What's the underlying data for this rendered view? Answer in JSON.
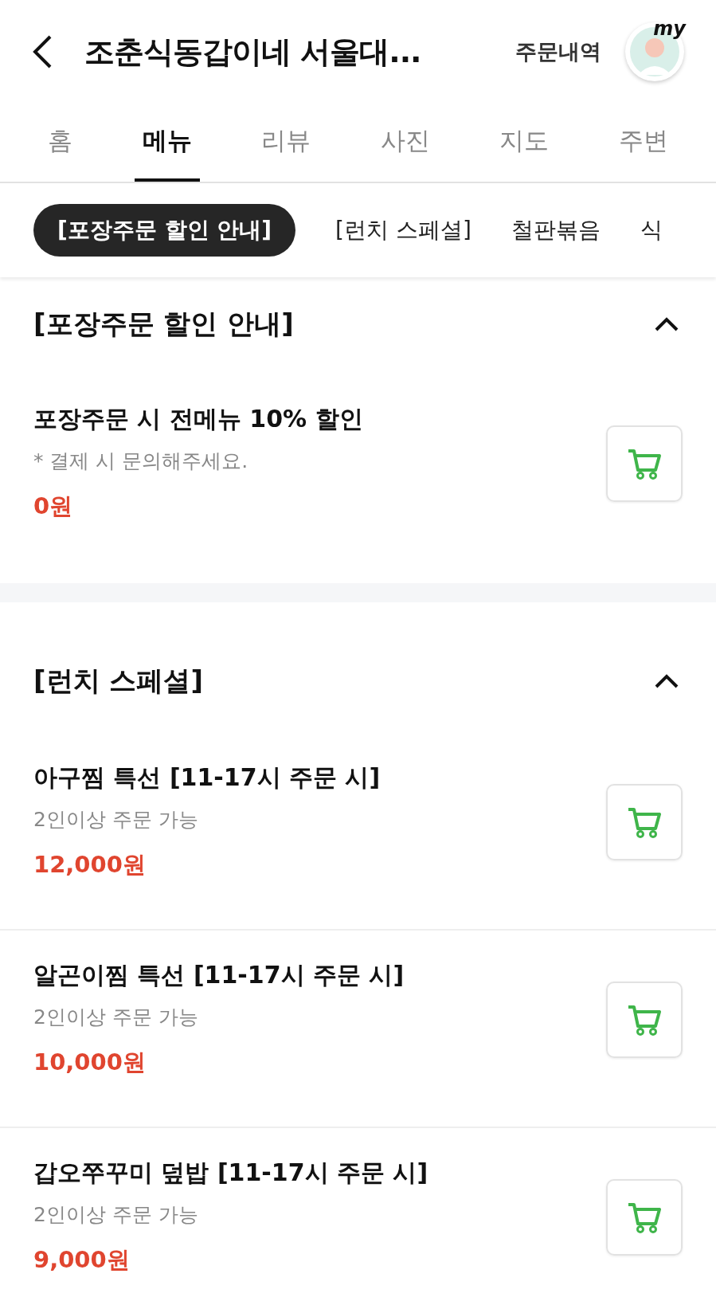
{
  "header": {
    "title": "조춘식동갑이네 서울대...",
    "order_history": "주문내역",
    "avatar_badge": "my"
  },
  "tabs": [
    {
      "label": "홈",
      "selected": false
    },
    {
      "label": "메뉴",
      "selected": true
    },
    {
      "label": "리뷰",
      "selected": false
    },
    {
      "label": "사진",
      "selected": false
    },
    {
      "label": "지도",
      "selected": false
    },
    {
      "label": "주변",
      "selected": false
    }
  ],
  "category_chips": [
    {
      "label": "[포장주문 할인 안내]",
      "selected": true
    },
    {
      "label": "[런치 스페셜]",
      "selected": false
    },
    {
      "label": "철판볶음",
      "selected": false
    },
    {
      "label": "식",
      "selected": false
    }
  ],
  "sections": [
    {
      "title": "[포장주문 할인 안내]",
      "expanded": true,
      "items": [
        {
          "name": "포장주문 시 전메뉴 10% 할인",
          "description": "* 결제 시 문의해주세요.",
          "price": "0원"
        }
      ]
    },
    {
      "title": "[런치 스페셜]",
      "expanded": true,
      "items": [
        {
          "name": "아구찜 특선 [11-17시 주문 시]",
          "description": "2인이상 주문 가능",
          "price": "12,000원"
        },
        {
          "name": "알곤이찜 특선 [11-17시 주문 시]",
          "description": "2인이상 주문 가능",
          "price": "10,000원"
        },
        {
          "name": "갑오쭈꾸미 덮밥 [11-17시 주문 시]",
          "description": "2인이상 주문 가능",
          "price": "9,000원"
        }
      ]
    }
  ]
}
